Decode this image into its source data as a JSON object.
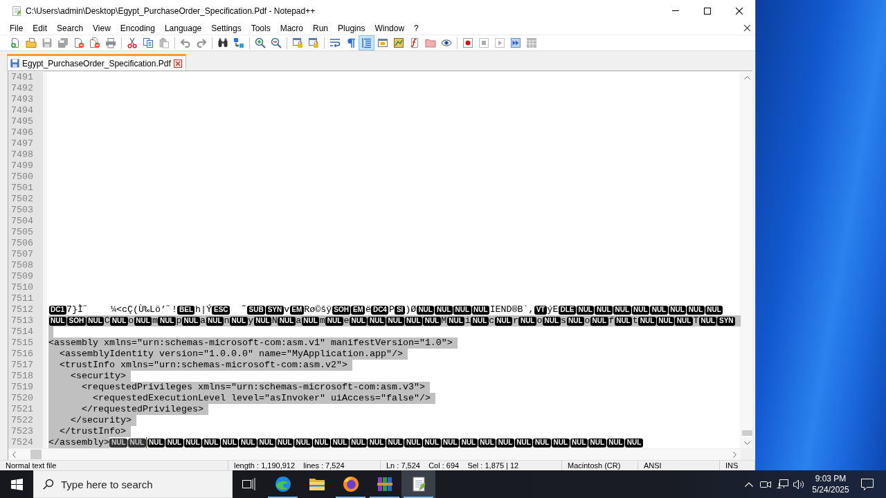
{
  "window": {
    "title": "C:\\Users\\admin\\Desktop\\Egypt_PurchaseOrder_Specification.Pdf - Notepad++"
  },
  "menu": [
    "File",
    "Edit",
    "Search",
    "View",
    "Encoding",
    "Language",
    "Settings",
    "Tools",
    "Macro",
    "Run",
    "Plugins",
    "Window",
    "?"
  ],
  "toolbar": [
    {
      "kind": "new",
      "disabled": false,
      "on": false
    },
    {
      "kind": "open",
      "disabled": false,
      "on": false
    },
    {
      "kind": "save",
      "disabled": true,
      "on": false
    },
    {
      "kind": "saveall",
      "disabled": true,
      "on": false
    },
    {
      "kind": "close",
      "disabled": false,
      "on": false
    },
    {
      "kind": "closeall",
      "disabled": false,
      "on": false
    },
    {
      "kind": "print",
      "disabled": false,
      "on": false
    },
    {
      "kind": "separator"
    },
    {
      "kind": "cut",
      "disabled": false,
      "on": false
    },
    {
      "kind": "copy",
      "disabled": false,
      "on": false
    },
    {
      "kind": "paste",
      "disabled": true,
      "on": false
    },
    {
      "kind": "separator"
    },
    {
      "kind": "undo",
      "disabled": true,
      "on": false
    },
    {
      "kind": "redo",
      "disabled": true,
      "on": false
    },
    {
      "kind": "separator"
    },
    {
      "kind": "find",
      "disabled": false,
      "on": false
    },
    {
      "kind": "replace",
      "disabled": false,
      "on": false
    },
    {
      "kind": "separator"
    },
    {
      "kind": "zoomin",
      "disabled": false,
      "on": false
    },
    {
      "kind": "zoomout",
      "disabled": false,
      "on": false
    },
    {
      "kind": "separator"
    },
    {
      "kind": "syncv",
      "disabled": false,
      "on": false
    },
    {
      "kind": "synch",
      "disabled": false,
      "on": false
    },
    {
      "kind": "separator"
    },
    {
      "kind": "wrap",
      "disabled": false,
      "on": false
    },
    {
      "kind": "allchars",
      "disabled": false,
      "on": false
    },
    {
      "kind": "indentguide",
      "disabled": false,
      "on": true
    },
    {
      "kind": "udl",
      "disabled": false,
      "on": false
    },
    {
      "kind": "docmap",
      "disabled": false,
      "on": false
    },
    {
      "kind": "functionlist",
      "disabled": false,
      "on": false
    },
    {
      "kind": "workspace",
      "disabled": false,
      "on": false
    },
    {
      "kind": "monitor",
      "disabled": false,
      "on": false
    },
    {
      "kind": "separator"
    },
    {
      "kind": "record",
      "disabled": false,
      "on": false
    },
    {
      "kind": "stop",
      "disabled": true,
      "on": false
    },
    {
      "kind": "play",
      "disabled": true,
      "on": false
    },
    {
      "kind": "playmulti",
      "disabled": false,
      "on": false
    },
    {
      "kind": "savemacro",
      "disabled": true,
      "on": false
    }
  ],
  "tabs": [
    {
      "label": "Egypt_PurchaseOrder_Specification.Pdf",
      "selected": true
    }
  ],
  "editor": {
    "lines": [
      {
        "number": "7491",
        "selected": false
      },
      {
        "number": "7492",
        "selected": false
      },
      {
        "number": "7493",
        "selected": false
      },
      {
        "number": "7494",
        "selected": false
      },
      {
        "number": "7495",
        "selected": false
      },
      {
        "number": "7496",
        "selected": false
      },
      {
        "number": "7497",
        "selected": false
      },
      {
        "number": "7498",
        "selected": false
      },
      {
        "number": "7499",
        "selected": false
      },
      {
        "number": "7500",
        "selected": false
      },
      {
        "number": "7501",
        "selected": false
      },
      {
        "number": "7502",
        "selected": false
      },
      {
        "number": "7503",
        "selected": false
      },
      {
        "number": "7504",
        "selected": false
      },
      {
        "number": "7505",
        "selected": false
      },
      {
        "number": "7506",
        "selected": false
      },
      {
        "number": "7507",
        "selected": false
      },
      {
        "number": "7508",
        "selected": false
      },
      {
        "number": "7509",
        "selected": false
      },
      {
        "number": "7510",
        "selected": false
      },
      {
        "number": "7511",
        "selected": false
      },
      {
        "number": "7512",
        "selected": false,
        "segments": [
          {
            "kind": "ctrl",
            "text": "DC1"
          },
          {
            "kind": "text",
            "text": "7}Ì˝    ¼<cÇ(Ù‰Lö’˝!"
          },
          {
            "kind": "ctrl",
            "text": "BEL"
          },
          {
            "kind": "text",
            "text": "h|Ý"
          },
          {
            "kind": "ctrl",
            "text": "ESC"
          },
          {
            "kind": "text",
            "text": "  ˜"
          },
          {
            "kind": "ctrl",
            "text": "SUB"
          },
          {
            "kind": "ctrl",
            "text": "SYN"
          },
          {
            "kind": "text",
            "text": "v"
          },
          {
            "kind": "ctrl",
            "text": "EM"
          },
          {
            "kind": "text",
            "text": "Rø©šÿ"
          },
          {
            "kind": "ctrl",
            "text": "SOH"
          },
          {
            "kind": "ctrl",
            "text": "EM"
          },
          {
            "kind": "text",
            "text": "ë"
          },
          {
            "kind": "ctrl",
            "text": "DC4"
          },
          {
            "kind": "text",
            "text": "P"
          },
          {
            "kind": "ctrl",
            "text": "SI"
          },
          {
            "kind": "text",
            "text": ")Ø"
          },
          {
            "kind": "ctrl",
            "text": "NUL"
          },
          {
            "kind": "ctrl",
            "text": "NUL"
          },
          {
            "kind": "ctrl",
            "text": "NUL"
          },
          {
            "kind": "ctrl",
            "text": "NUL"
          },
          {
            "kind": "text",
            "text": "IEND®B`,"
          },
          {
            "kind": "ctrl",
            "text": "VT"
          },
          {
            "kind": "text",
            "text": "ýE"
          },
          {
            "kind": "ctrl",
            "text": "DLE"
          },
          {
            "kind": "ctrl",
            "text": "NUL"
          },
          {
            "kind": "ctrl",
            "text": "NUL"
          },
          {
            "kind": "ctrl",
            "text": "NUL"
          },
          {
            "kind": "ctrl",
            "text": "NUL"
          },
          {
            "kind": "ctrl",
            "text": "NUL"
          },
          {
            "kind": "ctrl",
            "text": "NUL"
          },
          {
            "kind": "ctrl",
            "text": "NUL"
          },
          {
            "kind": "ctrl",
            "text": "NUL"
          }
        ]
      },
      {
        "number": "7513",
        "selected": true,
        "segments": [
          {
            "kind": "ctrl",
            "text": "NUL"
          },
          {
            "kind": "ctrl",
            "text": "SOH"
          },
          {
            "kind": "ctrl",
            "text": "NUL"
          },
          {
            "kind": "text",
            "text": "C"
          },
          {
            "kind": "ctrl",
            "text": "NUL"
          },
          {
            "kind": "text",
            "text": "o"
          },
          {
            "kind": "ctrl",
            "text": "NUL"
          },
          {
            "kind": "text",
            "text": "m"
          },
          {
            "kind": "ctrl",
            "text": "NUL"
          },
          {
            "kind": "text",
            "text": "p"
          },
          {
            "kind": "ctrl",
            "text": "NUL"
          },
          {
            "kind": "text",
            "text": "a"
          },
          {
            "kind": "ctrl",
            "text": "NUL"
          },
          {
            "kind": "text",
            "text": "n"
          },
          {
            "kind": "ctrl",
            "text": "NUL"
          },
          {
            "kind": "text",
            "text": "y"
          },
          {
            "kind": "ctrl",
            "text": "NUL"
          },
          {
            "kind": "text",
            "text": "N"
          },
          {
            "kind": "ctrl",
            "text": "NUL"
          },
          {
            "kind": "text",
            "text": "a"
          },
          {
            "kind": "ctrl",
            "text": "NUL"
          },
          {
            "kind": "text",
            "text": "m"
          },
          {
            "kind": "ctrl",
            "text": "NUL"
          },
          {
            "kind": "text",
            "text": "e"
          },
          {
            "kind": "ctrl",
            "text": "NUL"
          },
          {
            "kind": "ctrl",
            "text": "NUL"
          },
          {
            "kind": "ctrl",
            "text": "NUL"
          },
          {
            "kind": "ctrl",
            "text": "NUL"
          },
          {
            "kind": "ctrl",
            "text": "NUL"
          },
          {
            "kind": "text",
            "text": "M"
          },
          {
            "kind": "ctrl",
            "text": "NUL"
          },
          {
            "kind": "text",
            "text": "i"
          },
          {
            "kind": "ctrl",
            "text": "NUL"
          },
          {
            "kind": "text",
            "text": "c"
          },
          {
            "kind": "ctrl",
            "text": "NUL"
          },
          {
            "kind": "text",
            "text": "r"
          },
          {
            "kind": "ctrl",
            "text": "NUL"
          },
          {
            "kind": "text",
            "text": "o"
          },
          {
            "kind": "ctrl",
            "text": "NUL"
          },
          {
            "kind": "text",
            "text": "s"
          },
          {
            "kind": "ctrl",
            "text": "NUL"
          },
          {
            "kind": "text",
            "text": "o"
          },
          {
            "kind": "ctrl",
            "text": "NUL"
          },
          {
            "kind": "text",
            "text": "f"
          },
          {
            "kind": "ctrl",
            "text": "NUL"
          },
          {
            "kind": "text",
            "text": "t"
          },
          {
            "kind": "ctrl",
            "text": "NUL"
          },
          {
            "kind": "ctrl",
            "text": "NUL"
          },
          {
            "kind": "ctrl",
            "text": "NUL"
          },
          {
            "kind": "text",
            "text": "T"
          },
          {
            "kind": "ctrl",
            "text": "NUL"
          },
          {
            "kind": "ctrl",
            "text": "SYN"
          }
        ]
      },
      {
        "number": "7514",
        "selected": true
      },
      {
        "number": "7515",
        "selected": true,
        "segments": [
          {
            "kind": "text",
            "text": "<assembly xmlns=\"urn:schemas-microsoft-com:asm.v1\" manifestVersion=\"1.0\">"
          }
        ]
      },
      {
        "number": "7516",
        "selected": true,
        "segments": [
          {
            "kind": "text",
            "text": "  <assemblyIdentity version=\"1.0.0.0\" name=\"MyApplication.app\"/>"
          }
        ]
      },
      {
        "number": "7517",
        "selected": true,
        "segments": [
          {
            "kind": "text",
            "text": "  <trustInfo xmlns=\"urn:schemas-microsoft-com:asm.v2\">"
          }
        ]
      },
      {
        "number": "7518",
        "selected": true,
        "segments": [
          {
            "kind": "text",
            "text": "    <security>"
          }
        ]
      },
      {
        "number": "7519",
        "selected": true,
        "segments": [
          {
            "kind": "text",
            "text": "      <requestedPrivileges xmlns=\"urn:schemas-microsoft-com:asm.v3\">"
          }
        ]
      },
      {
        "number": "7520",
        "selected": true,
        "segments": [
          {
            "kind": "text",
            "text": "        <requestedExecutionLevel level=\"asInvoker\" uiAccess=\"false\"/>"
          }
        ]
      },
      {
        "number": "7521",
        "selected": true,
        "segments": [
          {
            "kind": "text",
            "text": "      </requestedPrivileges>"
          }
        ]
      },
      {
        "number": "7522",
        "selected": true,
        "segments": [
          {
            "kind": "text",
            "text": "    </security>"
          }
        ]
      },
      {
        "number": "7523",
        "selected": true,
        "segments": [
          {
            "kind": "text",
            "text": "  </trustInfo>"
          }
        ]
      },
      {
        "number": "7524",
        "selected": false,
        "segments": [
          {
            "kind": "text",
            "text": "</assembly>",
            "selected": true
          },
          {
            "kind": "ctrl",
            "text": "NUL",
            "selected": true
          },
          {
            "kind": "ctrl",
            "text": "NUL",
            "selected": true
          },
          {
            "kind": "caret"
          },
          {
            "kind": "ctrl",
            "text": "NUL",
            "selected": false
          },
          {
            "kind": "ctrl",
            "text": "NUL",
            "selected": false
          },
          {
            "kind": "ctrl",
            "text": "NUL",
            "selected": false
          },
          {
            "kind": "ctrl",
            "text": "NUL",
            "selected": false
          },
          {
            "kind": "ctrl",
            "text": "NUL",
            "selected": false
          },
          {
            "kind": "ctrl",
            "text": "NUL",
            "selected": false
          },
          {
            "kind": "ctrl",
            "text": "NUL",
            "selected": false
          },
          {
            "kind": "ctrl",
            "text": "NUL",
            "selected": false
          },
          {
            "kind": "ctrl",
            "text": "NUL",
            "selected": false
          },
          {
            "kind": "ctrl",
            "text": "NUL",
            "selected": false
          },
          {
            "kind": "ctrl",
            "text": "NUL",
            "selected": false
          },
          {
            "kind": "ctrl",
            "text": "NUL",
            "selected": false
          },
          {
            "kind": "ctrl",
            "text": "NUL",
            "selected": false
          },
          {
            "kind": "ctrl",
            "text": "NUL",
            "selected": false
          },
          {
            "kind": "ctrl",
            "text": "NUL",
            "selected": false
          },
          {
            "kind": "ctrl",
            "text": "NUL",
            "selected": false
          },
          {
            "kind": "ctrl",
            "text": "NUL",
            "selected": false
          },
          {
            "kind": "ctrl",
            "text": "NUL",
            "selected": false
          },
          {
            "kind": "ctrl",
            "text": "NUL",
            "selected": false
          },
          {
            "kind": "ctrl",
            "text": "NUL",
            "selected": false
          },
          {
            "kind": "ctrl",
            "text": "NUL",
            "selected": false
          },
          {
            "kind": "ctrl",
            "text": "NUL",
            "selected": false
          },
          {
            "kind": "ctrl",
            "text": "NUL",
            "selected": false
          },
          {
            "kind": "ctrl",
            "text": "NUL",
            "selected": false
          },
          {
            "kind": "ctrl",
            "text": "NUL",
            "selected": false
          },
          {
            "kind": "ctrl",
            "text": "NUL",
            "selected": false
          },
          {
            "kind": "ctrl",
            "text": "NUL",
            "selected": false
          }
        ]
      }
    ]
  },
  "status_bar": [
    "Normal text file",
    "length : 1,190,912    lines : 7,524",
    "Ln : 7,524    Col : 694    Sel : 1,875 | 12",
    "Macintosh (CR)",
    "ANSI",
    "INS"
  ],
  "taskbar": {
    "search": {
      "placeholder": "Type here to search"
    },
    "apps": [
      {
        "kind": "swirl",
        "running": true,
        "active": false
      },
      {
        "kind": "folder",
        "running": false,
        "active": false
      },
      {
        "kind": "globe",
        "running": true,
        "active": false
      },
      {
        "kind": "archive",
        "running": true,
        "active": false
      },
      {
        "kind": "notepad",
        "running": true,
        "active": true
      }
    ],
    "clock": {
      "time": "9:03 PM",
      "date": "5/24/2025"
    }
  }
}
